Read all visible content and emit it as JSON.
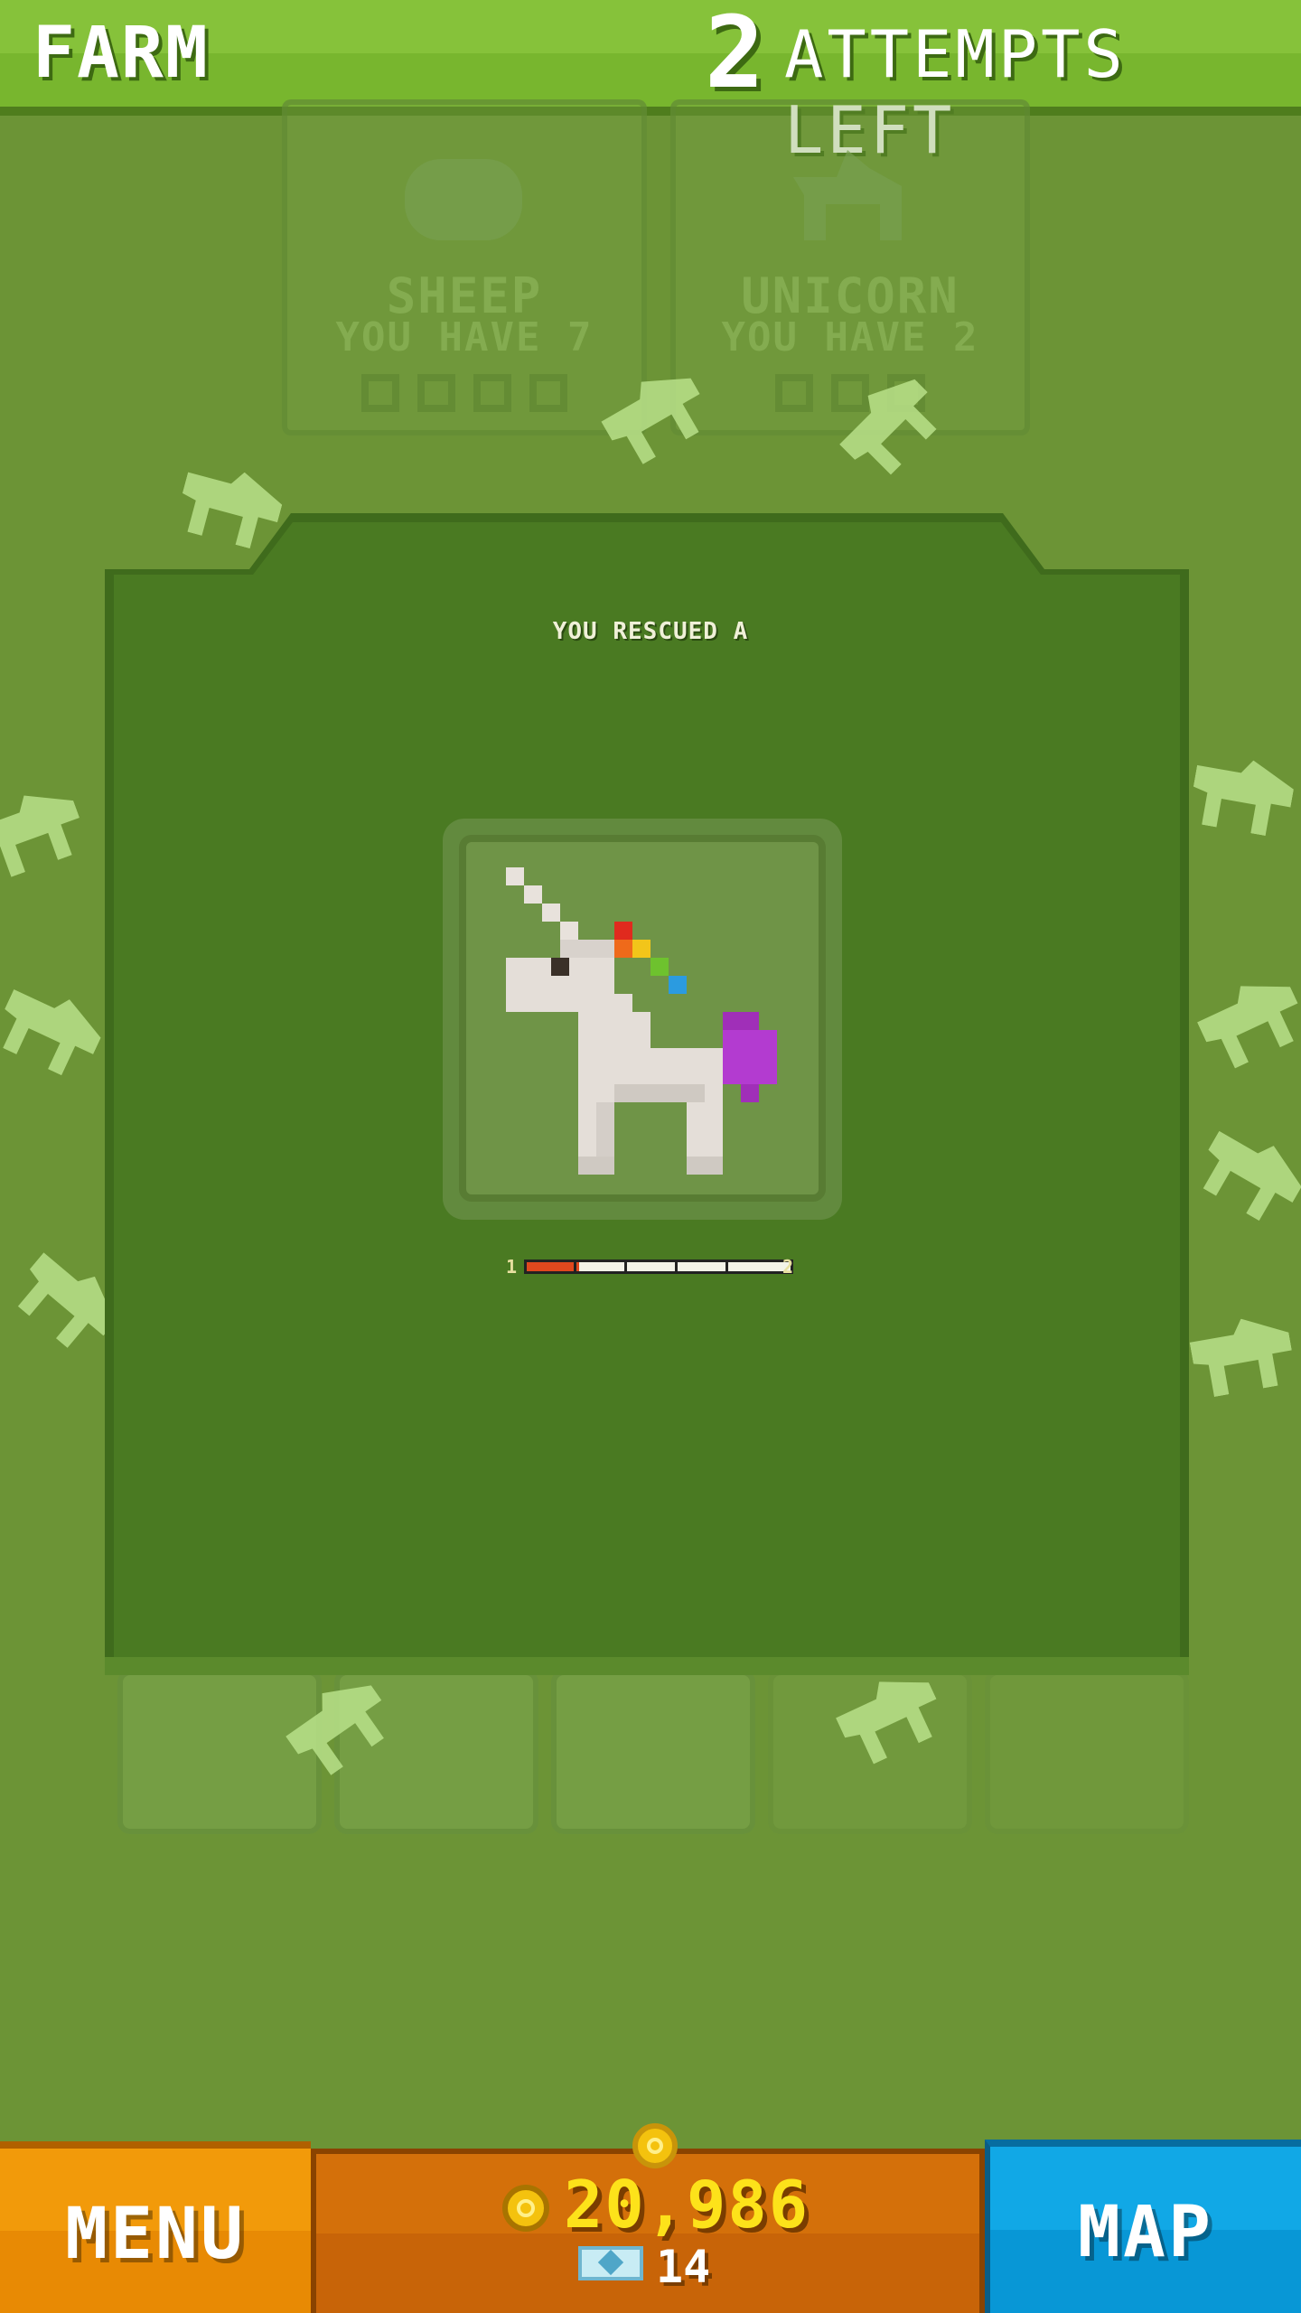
{
  "header": {
    "title": "FARM",
    "attempts_count": "2",
    "attempts_label": "ATTEMPTS LEFT"
  },
  "background_cards": [
    {
      "name": "SHEEP",
      "have": "YOU HAVE 7"
    },
    {
      "name": "UNICORN",
      "have": "YOU HAVE 2"
    }
  ],
  "dialog": {
    "title": "YOU RESCUED A",
    "animal_icon": "unicorn-icon",
    "progress": {
      "from": "1",
      "to": "2",
      "fraction": 0.2,
      "segments": 5
    }
  },
  "footer": {
    "menu_label": "MENU",
    "map_label": "MAP",
    "coins": "20,986",
    "gems": "14"
  },
  "colors": {
    "field": "#6c9436",
    "topbar": "#86c23a",
    "menu": "#f29a0a",
    "map": "#11a8e6",
    "coin_text": "#fde21a",
    "progress_fill": "#e0481e"
  }
}
